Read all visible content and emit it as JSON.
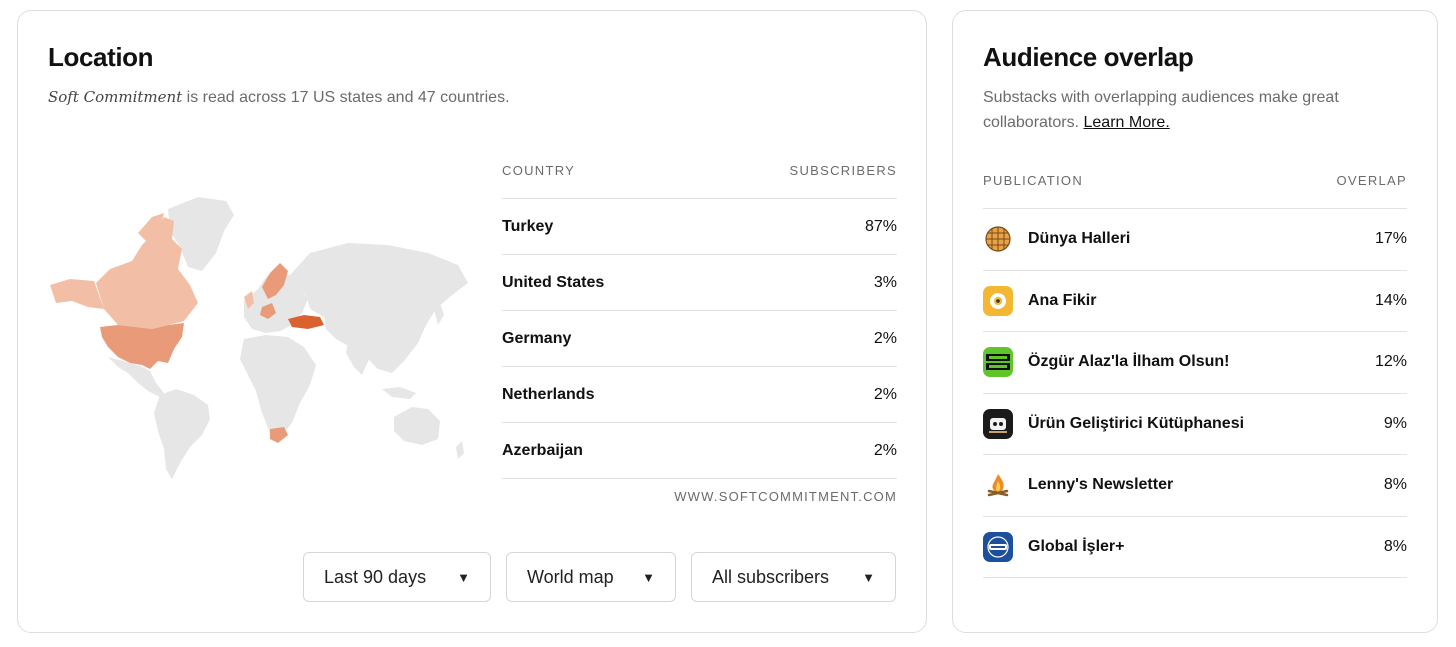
{
  "location": {
    "title": "Location",
    "subtitle_pub": "Soft Commitment",
    "subtitle_rest": " is read across 17 US states and 47 countries.",
    "table": {
      "col_country": "COUNTRY",
      "col_subscribers": "SUBSCRIBERS",
      "rows": [
        {
          "country": "Turkey",
          "value": "87%"
        },
        {
          "country": "United States",
          "value": "3%"
        },
        {
          "country": "Germany",
          "value": "2%"
        },
        {
          "country": "Netherlands",
          "value": "2%"
        },
        {
          "country": "Azerbaijan",
          "value": "2%"
        }
      ],
      "source": "WWW.SOFTCOMMITMENT.COM"
    },
    "dropdowns": {
      "range": "Last 90 days",
      "view": "World map",
      "audience": "All subscribers"
    },
    "map_colors": {
      "land": "#e6e6e6",
      "low": "#f2bfa6",
      "mid": "#e99a78",
      "high": "#d9622f"
    }
  },
  "overlap": {
    "title": "Audience overlap",
    "subtitle": "Substacks with overlapping audiences make great collaborators. ",
    "learn_more": "Learn More.",
    "table": {
      "col_publication": "PUBLICATION",
      "col_overlap": "OVERLAP",
      "rows": [
        {
          "name": "Dünya Halleri",
          "value": "17%",
          "icon": "globe-grid-icon"
        },
        {
          "name": "Ana Fikir",
          "value": "14%",
          "icon": "idea-sun-icon"
        },
        {
          "name": "Özgür Alaz'la İlham Olsun!",
          "value": "12%",
          "icon": "ilham-olsun-logo"
        },
        {
          "name": "Ürün Geliştirici Kütüphanesi",
          "value": "9%",
          "icon": "book-robot-icon"
        },
        {
          "name": "Lenny's Newsletter",
          "value": "8%",
          "icon": "campfire-icon"
        },
        {
          "name": "Global İşler+",
          "value": "8%",
          "icon": "global-isler-logo"
        }
      ]
    }
  }
}
